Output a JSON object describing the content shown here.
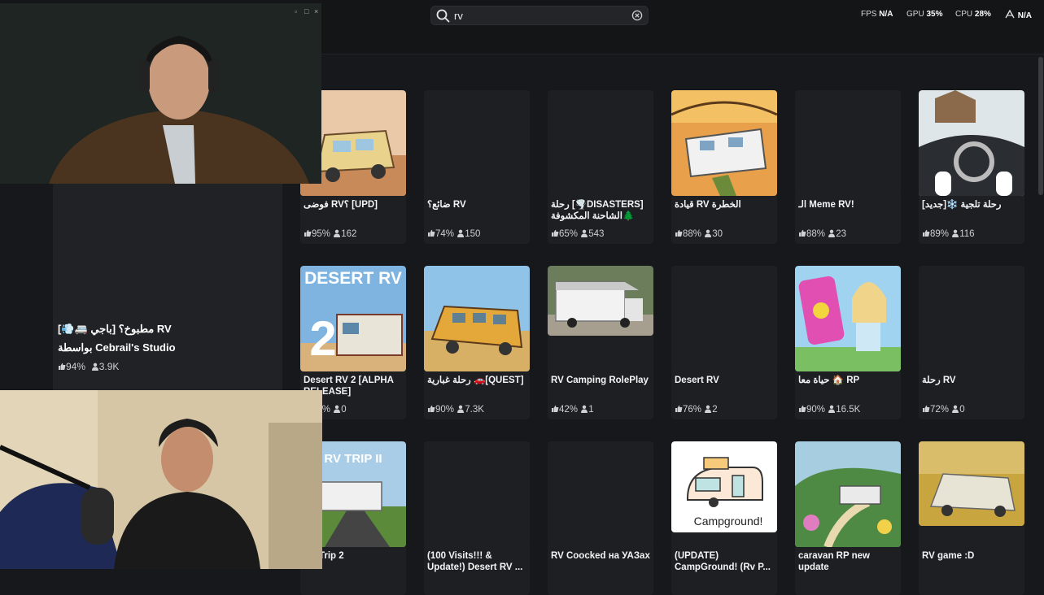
{
  "search": {
    "value": "rv"
  },
  "stats": {
    "fps_label": "FPS",
    "fps_value": "N/A",
    "gpu_label": "GPU",
    "gpu_value": "35%",
    "cpu_label": "CPU",
    "cpu_value": "28%",
    "net_value": "N/A"
  },
  "featured": {
    "title": "مطبوخ؟ [باجي 🚐💨] RV",
    "studio": "بواسطة Cebrail's Studio",
    "rating": "94%",
    "players": "3.9K"
  },
  "games": [
    {
      "title": "فوضى RV؟ [UPD]",
      "rating": "95%",
      "players": "162"
    },
    {
      "title": "ضائع؟ RV",
      "rating": "74%",
      "players": "150"
    },
    {
      "title": "رحلة [🌪️DISASTERS] الشاحنة المكشوفة🌲",
      "rating": "65%",
      "players": "543"
    },
    {
      "title": "قيادة RV الخطرة",
      "rating": "88%",
      "players": "30"
    },
    {
      "title": "الـ Meme RV!",
      "rating": "88%",
      "players": "23"
    },
    {
      "title": "رحلة تلجية ❄️[جديد]",
      "rating": "89%",
      "players": "116"
    },
    {
      "title": "Desert RV 2 [ALPHA RELEASE]",
      "rating": "75%",
      "players": "0"
    },
    {
      "title": "رحلة غبارية 🚗[QUEST]",
      "rating": "90%",
      "players": "7.3K"
    },
    {
      "title": "RV Camping RolePlay",
      "rating": "42%",
      "players": "1"
    },
    {
      "title": "Desert RV",
      "rating": "76%",
      "players": "2"
    },
    {
      "title": "حياة معا 🏠 RP",
      "rating": "90%",
      "players": "16.5K"
    },
    {
      "title": "رحلة RV",
      "rating": "72%",
      "players": "0"
    },
    {
      "title": "RV Trip 2",
      "rating": "",
      "players": ""
    },
    {
      "title": "(100 Visits!!! & Update!) Desert RV ...",
      "rating": "",
      "players": ""
    },
    {
      "title": "RV Coocked на УАЗах",
      "rating": "",
      "players": ""
    },
    {
      "title": "(UPDATE) CampGround! (Rv P...",
      "rating": "",
      "players": ""
    },
    {
      "title": "caravan RP new update",
      "rating": "",
      "players": ""
    },
    {
      "title": "RV game :D",
      "rating": "",
      "players": ""
    }
  ],
  "thumb_text": {
    "desert_rv_2_title": "DESERT RV",
    "desert_rv_2_number": "2",
    "rv_trip_2": "RV TRIP II",
    "campground": "Campground!"
  },
  "colors": {
    "background": "#17181b",
    "card": "#1d1f22",
    "search_bg": "#232529"
  }
}
